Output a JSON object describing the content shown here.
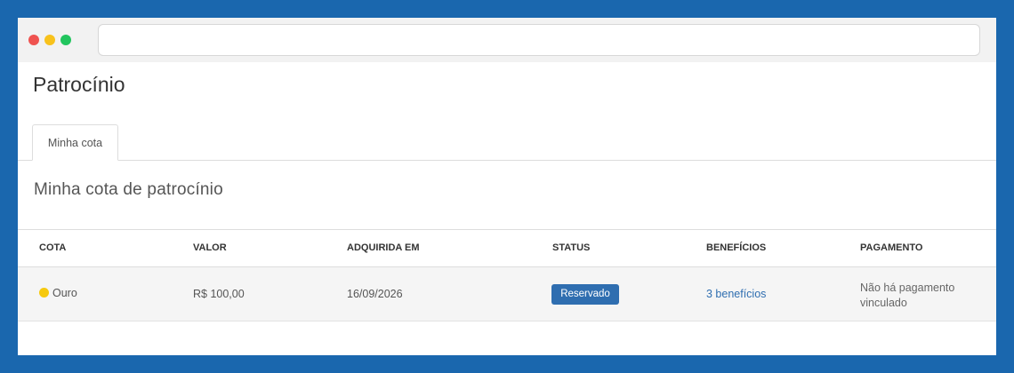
{
  "page": {
    "title": "Patrocínio"
  },
  "tabs": [
    {
      "label": "Minha cota",
      "active": true
    }
  ],
  "section": {
    "title": "Minha cota de patrocínio"
  },
  "table": {
    "headers": [
      "COTA",
      "VALOR",
      "ADQUIRIDA EM",
      "STATUS",
      "BENEFÍCIOS",
      "PAGAMENTO"
    ],
    "rows": [
      {
        "cota": "Ouro",
        "cota_color": "#f6c90e",
        "valor": "R$ 100,00",
        "adquirida_em": "16/09/2026",
        "status": "Reservado",
        "beneficios": "3 benefícios",
        "pagamento": "Não há pagamento vinculado"
      }
    ]
  },
  "colors": {
    "frame": "#1a67ae",
    "badge": "#2f6eb0",
    "link": "#2f6eb0"
  }
}
